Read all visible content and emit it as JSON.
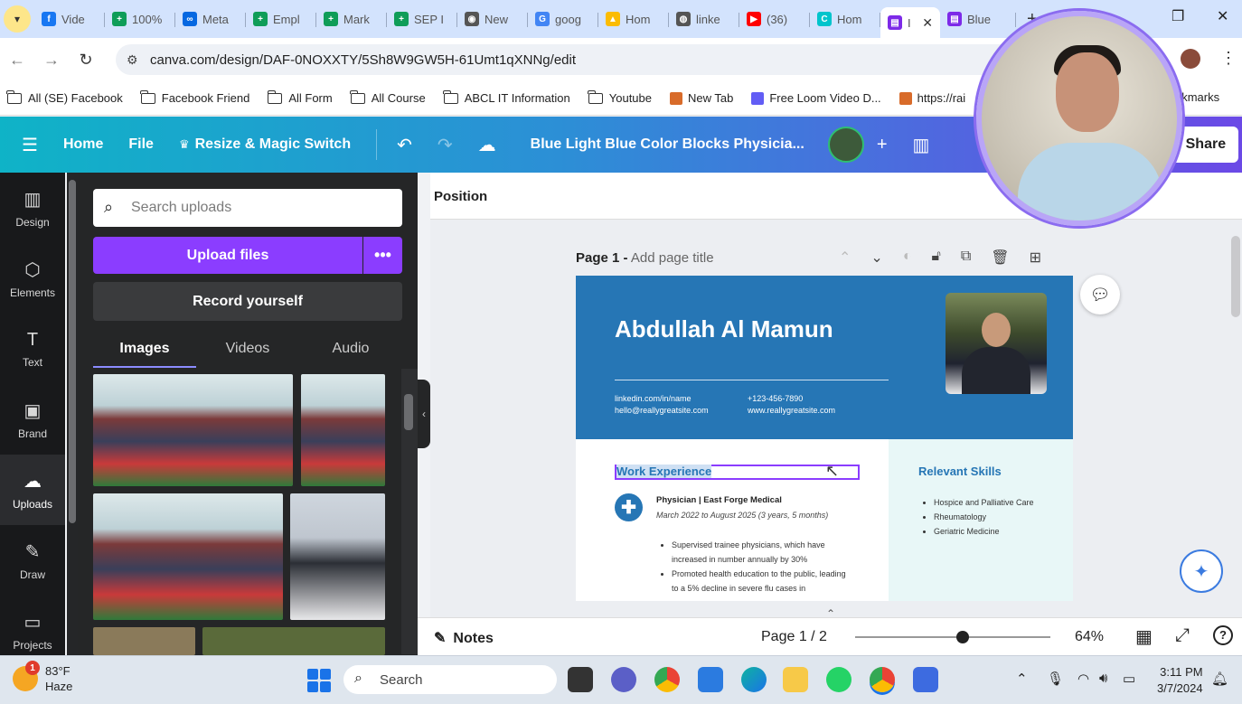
{
  "browser": {
    "tabs": [
      {
        "label": "Vide",
        "icon": "facebook-icon",
        "color": "#1877f2",
        "glyph": "f"
      },
      {
        "label": "100%",
        "icon": "sheets-icon",
        "color": "#0f9d58",
        "glyph": "+"
      },
      {
        "label": "Meta",
        "icon": "meta-icon",
        "color": "#0668e1",
        "glyph": "∞"
      },
      {
        "label": "Empl",
        "icon": "sheets-icon",
        "color": "#0f9d58",
        "glyph": "+"
      },
      {
        "label": "Mark",
        "icon": "sheets-icon",
        "color": "#0f9d58",
        "glyph": "+"
      },
      {
        "label": "SEP I",
        "icon": "sheets-icon",
        "color": "#0f9d58",
        "glyph": "+"
      },
      {
        "label": "New",
        "icon": "chrome-icon",
        "color": "#555555",
        "glyph": "◉"
      },
      {
        "label": "goog",
        "icon": "google-icon",
        "color": "#4285f4",
        "glyph": "G"
      },
      {
        "label": "Hom",
        "icon": "drive-icon",
        "color": "#fbbc04",
        "glyph": "▲"
      },
      {
        "label": "linke",
        "icon": "globe-icon",
        "color": "#555555",
        "glyph": "◍"
      },
      {
        "label": "(36)",
        "icon": "youtube-icon",
        "color": "#ff0000",
        "glyph": "▶"
      },
      {
        "label": "Hom",
        "icon": "canva-icon",
        "color": "#00c4cc",
        "glyph": "C"
      }
    ],
    "active_tab": {
      "label": "I",
      "icon": "canva-icon",
      "color": "#7d2ae8",
      "glyph": "▤"
    },
    "next_tab": {
      "label": "Blue",
      "icon": "canva-icon",
      "color": "#7d2ae8",
      "glyph": "▤"
    },
    "url": "canva.com/design/DAF-0NOXXTY/5Sh8W9GW5H-61Umt1qXNNg/edit",
    "bookmarks": [
      {
        "label": "All (SE) Facebook",
        "icon": "folder-icon"
      },
      {
        "label": "Facebook Friend",
        "icon": "folder-icon"
      },
      {
        "label": "All Form",
        "icon": "folder-icon"
      },
      {
        "label": "All Course",
        "icon": "folder-icon"
      },
      {
        "label": "ABCL IT Information",
        "icon": "folder-icon"
      },
      {
        "label": "Youtube",
        "icon": "folder-icon"
      },
      {
        "label": "New Tab",
        "icon": "page-icon"
      },
      {
        "label": "Free Loom Video D...",
        "icon": "loom-icon"
      },
      {
        "label": "https://rai",
        "icon": "page-icon"
      }
    ],
    "bookmarks_end": "okmarks"
  },
  "canva": {
    "home": "Home",
    "file": "File",
    "resize": "Resize & Magic Switch",
    "doc_title": "Blue Light Blue Color Blocks Physicia...",
    "share": "Share",
    "rail": [
      {
        "label": "Design",
        "icon": "design-icon",
        "glyph": "▥"
      },
      {
        "label": "Elements",
        "icon": "elements-icon",
        "glyph": "⬡"
      },
      {
        "label": "Text",
        "icon": "text-icon",
        "glyph": "T"
      },
      {
        "label": "Brand",
        "icon": "brand-icon",
        "glyph": "▣"
      },
      {
        "label": "Uploads",
        "icon": "upload-cloud-icon",
        "glyph": "☁"
      },
      {
        "label": "Draw",
        "icon": "draw-icon",
        "glyph": "✎"
      },
      {
        "label": "Projects",
        "icon": "projects-icon",
        "glyph": "▭"
      }
    ],
    "uploads": {
      "search_placeholder": "Search uploads",
      "upload_files": "Upload files",
      "record_yourself": "Record yourself",
      "tabs": [
        "Images",
        "Videos",
        "Audio"
      ]
    },
    "editor": {
      "position": "Position",
      "page_label": "Page 1 -",
      "page_title_placeholder": "Add page title",
      "notes": "Notes",
      "page_count": "Page 1 / 2",
      "zoom": "64%",
      "zoom_fraction": 0.55
    },
    "resume": {
      "name": "Abdullah Al Mamun",
      "contact_left": [
        "linkedin.com/in/name",
        "hello@reallygreatsite.com"
      ],
      "contact_right": [
        "+123-456-7890",
        "www.reallygreatsite.com"
      ],
      "work_title": "Work Experience",
      "job_title": "Physician | East Forge Medical",
      "job_date": "March 2022 to August 2025 (3 years, 5 months)",
      "bullets": [
        "Supervised trainee physicians, which have increased in number annually by 30%",
        "Promoted health education to the public, leading to a 5% decline in severe flu cases in"
      ],
      "skills_title": "Relevant Skills",
      "skills": [
        "Hospice and Palliative Care",
        "Rheumatology",
        "Geriatric Medicine"
      ]
    }
  },
  "taskbar": {
    "temp": "83°F",
    "condition": "Haze",
    "badge": "1",
    "search": "Search",
    "time": "3:11 PM",
    "date": "3/7/2024"
  }
}
